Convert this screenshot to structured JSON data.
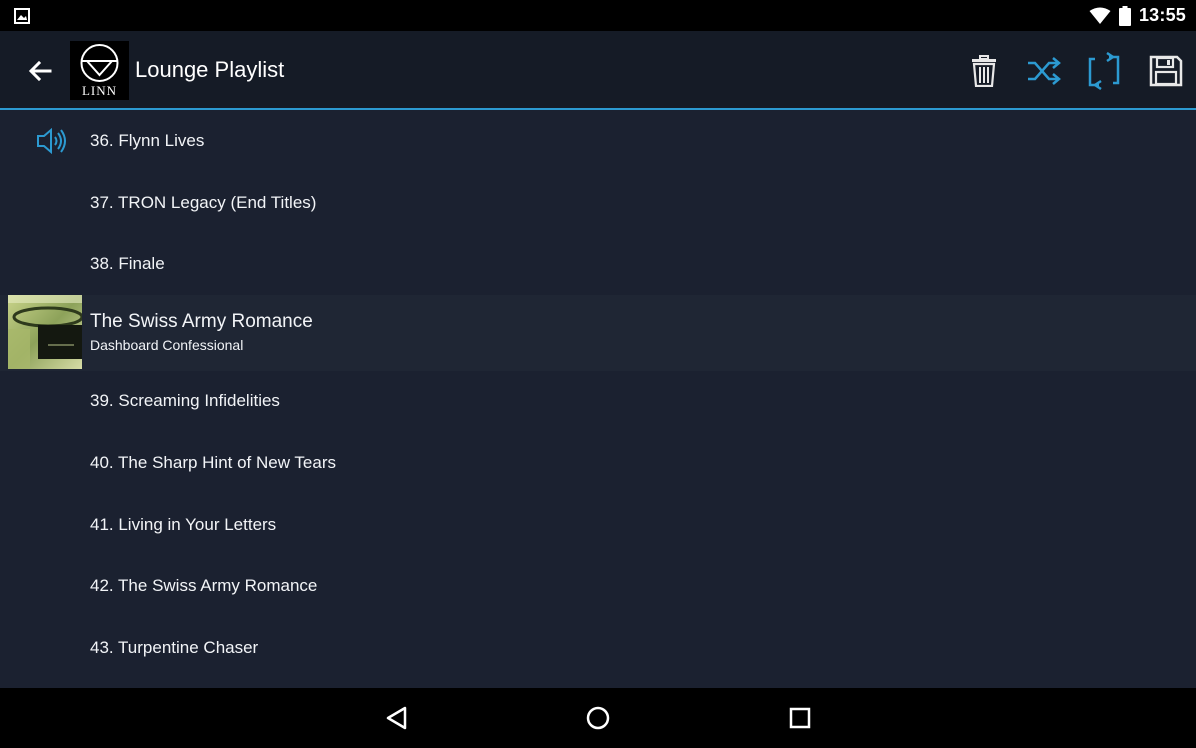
{
  "status_bar": {
    "time": "13:55",
    "icons": [
      "image-notification-icon",
      "wifi-icon",
      "battery-icon"
    ]
  },
  "action_bar": {
    "title": "Lounge Playlist",
    "logo_text": "LINN",
    "accent_color": "#2c9ad1",
    "buttons": [
      "back-arrow-icon",
      "delete-icon",
      "shuffle-icon",
      "repeat-icon",
      "save-icon"
    ]
  },
  "playlist": {
    "tracks_before": [
      {
        "label": "36. Flynn Lives",
        "now_playing": true
      },
      {
        "label": "37. TRON Legacy (End Titles)",
        "now_playing": false
      },
      {
        "label": "38. Finale",
        "now_playing": false
      }
    ],
    "album": {
      "title": "The Swiss Army Romance",
      "artist": "Dashboard Confessional"
    },
    "tracks_after": [
      {
        "label": "39. Screaming Infidelities"
      },
      {
        "label": "40. The Sharp Hint of New Tears"
      },
      {
        "label": "41. Living in Your Letters"
      },
      {
        "label": "42. The Swiss Army Romance"
      },
      {
        "label": "43. Turpentine Chaser"
      }
    ]
  },
  "nav_bar": {
    "buttons": [
      "back-triangle-icon",
      "home-circle-icon",
      "recents-square-icon"
    ]
  }
}
